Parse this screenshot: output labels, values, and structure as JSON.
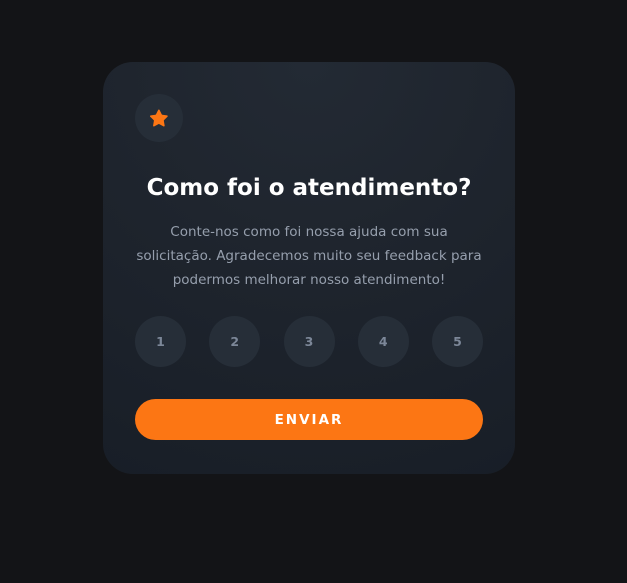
{
  "card": {
    "icon": "star-icon",
    "title": "Como foi o atendimento?",
    "description": "Conte-nos como foi nossa ajuda com sua solicitação. Agradecemos muito seu feedback para podermos melhorar nosso atendimento!",
    "ratings": [
      "1",
      "2",
      "3",
      "4",
      "5"
    ],
    "submit_label": "ENVIAR"
  },
  "colors": {
    "page_background": "#131417",
    "card_background": "#1f252e",
    "accent": "#fc7614",
    "rating_background": "#262e38",
    "rating_text": "#7c8798",
    "description_text": "#969fad"
  }
}
